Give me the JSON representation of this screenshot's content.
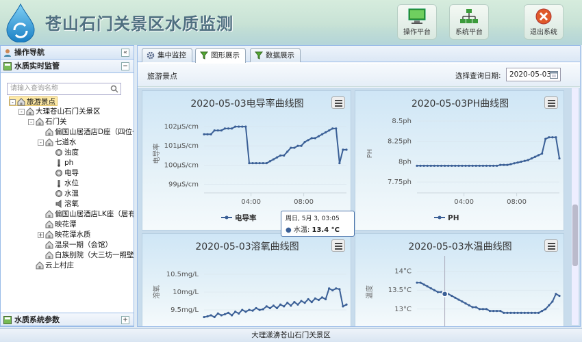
{
  "header": {
    "title": "苍山石门关景区水质监测",
    "buttons": [
      {
        "label": "操作平台",
        "icon": "monitor-icon"
      },
      {
        "label": "系统平台",
        "icon": "network-icon"
      },
      {
        "label": "退出系统",
        "icon": "exit-icon"
      }
    ]
  },
  "sidebar": {
    "title": "操作导航",
    "section1": "水质实时监管",
    "search_placeholder": "请输入查询名称",
    "tree": [
      {
        "label": "旅游景点",
        "depth": 0,
        "exp": "-",
        "icon": "house",
        "selected": true
      },
      {
        "label": "大理苍山石门关景区",
        "depth": 1,
        "exp": "-",
        "icon": "house"
      },
      {
        "label": "石门关",
        "depth": 2,
        "exp": "-",
        "icon": "house"
      },
      {
        "label": "偏国山居酒店D座（四位一",
        "depth": 3,
        "exp": "",
        "icon": "house"
      },
      {
        "label": "七道水",
        "depth": 3,
        "exp": "-",
        "icon": "house"
      },
      {
        "label": "浊度",
        "depth": 4,
        "exp": "",
        "icon": "sensor"
      },
      {
        "label": "ph",
        "depth": 4,
        "exp": "",
        "icon": "probe"
      },
      {
        "label": "电导",
        "depth": 4,
        "exp": "",
        "icon": "sensor"
      },
      {
        "label": "水位",
        "depth": 4,
        "exp": "",
        "icon": "probe"
      },
      {
        "label": "水温",
        "depth": 4,
        "exp": "",
        "icon": "sensor"
      },
      {
        "label": "溶氧",
        "depth": 4,
        "exp": "",
        "icon": "speaker"
      },
      {
        "label": "偏国山居酒店LK座（居有",
        "depth": 3,
        "exp": "",
        "icon": "house"
      },
      {
        "label": "映花潭",
        "depth": 3,
        "exp": "",
        "icon": "house"
      },
      {
        "label": "映花潭水质",
        "depth": 3,
        "exp": "+",
        "icon": "house"
      },
      {
        "label": "温泉一期（会馆）",
        "depth": 3,
        "exp": "",
        "icon": "house"
      },
      {
        "label": "白族别院（大三坊一照壁",
        "depth": 3,
        "exp": "",
        "icon": "house"
      },
      {
        "label": "云上村庄",
        "depth": 2,
        "exp": "",
        "icon": "house"
      }
    ],
    "section2": "水质系统参数"
  },
  "tabs": [
    {
      "label": "集中监控",
      "icon": "gear-icon",
      "active": false
    },
    {
      "label": "图形展示",
      "icon": "filter-icon",
      "active": true
    },
    {
      "label": "数据展示",
      "icon": "filter-icon",
      "active": false
    }
  ],
  "toolbar": {
    "spot": "旅游景点",
    "date_label": "选择查询日期:",
    "date_value": "2020-05-03"
  },
  "footer": "大理漾濞苍山石门关景区",
  "tooltip": {
    "line1": "周日, 5月 3, 03:05",
    "label": "水温:",
    "value": "13.4 °C"
  },
  "chart_data": [
    {
      "type": "line",
      "title": "2020-05-03电导率曲线图",
      "ylabel": "电导率",
      "yticks": [
        "102μS/cm",
        "101μS/cm",
        "100μS/cm",
        "99μS/cm"
      ],
      "ylim": [
        98.7,
        102.5
      ],
      "xticks": [
        "04:00",
        "08:00"
      ],
      "legend": "电导率",
      "color": "#3a5f96",
      "values": [
        101.6,
        101.6,
        101.6,
        101.8,
        101.8,
        101.8,
        101.9,
        101.9,
        101.9,
        102.0,
        102.0,
        102.0,
        102.0,
        100.1,
        100.1,
        100.1,
        100.1,
        100.1,
        100.1,
        100.2,
        100.3,
        100.4,
        100.5,
        100.5,
        100.7,
        100.9,
        100.9,
        101.0,
        101.0,
        101.2,
        101.3,
        101.4,
        101.4,
        101.5,
        101.6,
        101.7,
        101.8,
        101.9,
        101.9,
        100.1,
        100.8,
        100.8
      ]
    },
    {
      "type": "line",
      "title": "2020-05-03PH曲线图",
      "ylabel": "PH",
      "yticks": [
        "8.5ph",
        "8.25ph",
        "8ph",
        "7.75ph"
      ],
      "ylim": [
        7.65,
        8.55
      ],
      "xticks": [
        "04:00",
        "08:00"
      ],
      "legend": "PH",
      "color": "#3a5f96",
      "values": [
        7.95,
        7.95,
        7.95,
        7.95,
        7.95,
        7.95,
        7.95,
        7.95,
        7.95,
        7.95,
        7.95,
        7.95,
        7.95,
        7.95,
        7.95,
        7.95,
        7.95,
        7.95,
        7.95,
        7.95,
        7.95,
        7.95,
        7.95,
        7.95,
        7.96,
        7.96,
        7.96,
        7.97,
        7.98,
        7.99,
        8.0,
        8.01,
        8.02,
        8.04,
        8.06,
        8.08,
        8.1,
        8.28,
        8.3,
        8.3,
        8.3,
        8.04
      ]
    },
    {
      "type": "line",
      "title": "2020-05-03溶氧曲线图",
      "ylabel": "溶氧",
      "yticks": [
        "10.5mg/L",
        "10mg/L",
        "9.5mg/L"
      ],
      "ylim": [
        9.1,
        10.9
      ],
      "xticks": [],
      "legend": "",
      "color": "#3a5f96",
      "values": [
        9.3,
        9.32,
        9.35,
        9.3,
        9.4,
        9.35,
        9.38,
        9.42,
        9.35,
        9.45,
        9.4,
        9.5,
        9.45,
        9.5,
        9.48,
        9.55,
        9.5,
        9.52,
        9.6,
        9.55,
        9.62,
        9.55,
        9.65,
        9.6,
        9.7,
        9.62,
        9.72,
        9.65,
        9.75,
        9.7,
        9.8,
        9.72,
        9.82,
        9.78,
        9.85,
        9.8,
        10.1,
        10.05,
        10.1,
        10.08,
        9.6,
        9.65
      ]
    },
    {
      "type": "line",
      "title": "2020-05-03水温曲线图",
      "ylabel": "温度",
      "yticks": [
        "14°C",
        "13.5°C",
        "13°C"
      ],
      "ylim": [
        12.6,
        14.3
      ],
      "xticks": [],
      "legend": "",
      "color": "#3a5f96",
      "values": [
        13.7,
        13.7,
        13.65,
        13.6,
        13.55,
        13.5,
        13.45,
        13.45,
        13.4,
        13.4,
        13.35,
        13.3,
        13.25,
        13.2,
        13.15,
        13.1,
        13.05,
        13.05,
        13.0,
        13.0,
        13.0,
        12.95,
        12.95,
        12.95,
        12.95,
        12.9,
        12.9,
        12.9,
        12.9,
        12.9,
        12.9,
        12.9,
        12.9,
        12.9,
        12.9,
        12.9,
        12.95,
        13.0,
        13.1,
        13.2,
        13.4,
        13.35
      ]
    }
  ]
}
